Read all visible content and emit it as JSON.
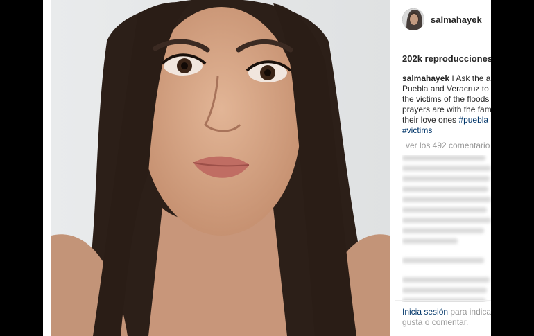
{
  "post": {
    "username": "salmahayek",
    "views": "202k reproducciones",
    "caption": {
      "user": "salmahayek",
      "line1_rest": " I Ask the au",
      "line2": "Puebla and Veracruz to",
      "line3": "the victims of the floods",
      "line4": "prayers are with the fam",
      "line5_text": "their love ones ",
      "line5_tag": "#puebla",
      "line6_tag": "#victims"
    },
    "view_comments": "ver los 492 comentario",
    "footer": {
      "login": "Inicia sesión",
      "line1_rest": " para indica",
      "line2": "gusta o comentar."
    }
  },
  "colors": {
    "link": "#003569",
    "muted": "#999999",
    "text": "#262626"
  },
  "icons": {
    "avatar": "profile-photo"
  }
}
